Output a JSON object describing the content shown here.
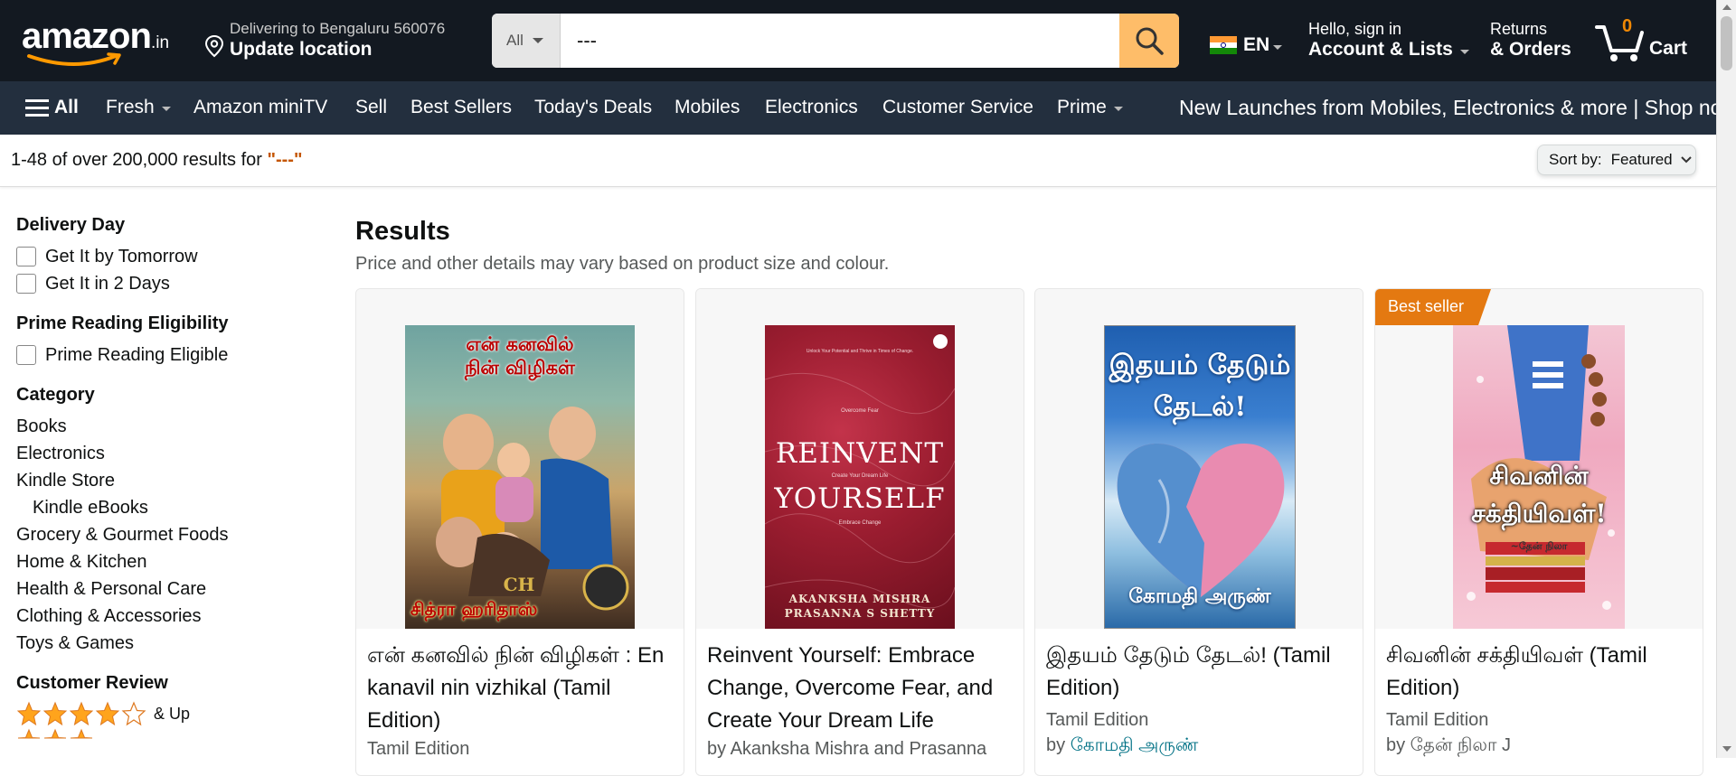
{
  "header": {
    "logo_text": "amazon",
    "logo_tld": ".in",
    "deliver_line1": "Delivering to Bengaluru 560076",
    "deliver_line2": "Update location",
    "search_category": "All",
    "search_value": "---",
    "language": "EN",
    "account_line1": "Hello, sign in",
    "account_line2": "Account & Lists",
    "orders_line1": "Returns",
    "orders_line2": "& Orders",
    "cart_count": "0",
    "cart_label": "Cart",
    "colors": {
      "nav_bg": "#131921",
      "subnav_bg": "#232f3e",
      "search_button": "#febd69",
      "cart_count": "#f08804"
    }
  },
  "subnav": {
    "all": "All",
    "items": [
      "Fresh",
      "Amazon miniTV",
      "Sell",
      "Best Sellers",
      "Today's Deals",
      "Mobiles",
      "Electronics",
      "Customer Service",
      "Prime"
    ],
    "promo": "New Launches from Mobiles, Electronics & more | Shop now"
  },
  "results_bar": {
    "prefix": "1-48 of over 200,000 results for ",
    "query": "\"---\"",
    "sort_label": "Sort by:",
    "sort_value": "Featured"
  },
  "sidebar": {
    "delivery_heading": "Delivery Day",
    "delivery_options": [
      "Get It by Tomorrow",
      "Get It in 2 Days"
    ],
    "prime_heading": "Prime Reading Eligibility",
    "prime_option": "Prime Reading Eligible",
    "category_heading": "Category",
    "categories": [
      "Books",
      "Electronics",
      "Kindle Store",
      "Kindle eBooks",
      "Grocery & Gourmet Foods",
      "Home & Kitchen",
      "Health & Personal Care",
      "Clothing & Accessories",
      "Toys & Games"
    ],
    "review_heading": "Customer Review",
    "review_stars": 4,
    "review_suffix": "& Up"
  },
  "main": {
    "heading": "Results",
    "subheading": "Price and other details may vary based on product size and colour.",
    "products": [
      {
        "title": "என் கனவில் நின் விழிகள் : En kanavil nin vizhikal (Tamil Edition)",
        "edition": "Tamil Edition",
        "cover_top": "என் கனவில்",
        "cover_mid": "நின் விழிகள்",
        "cover_author": "சித்ரா ஹரிதாஸ்",
        "cover_mark": "CH"
      },
      {
        "title": "Reinvent Yourself: Embrace Change, Overcome Fear, and Create Your Dream Life",
        "author_prefix": "by Akanksha Mishra and Prasanna",
        "cover_small_top": "Unlock Your Potential and Thrive in Times of Change.",
        "cover_line1": "REINVENT",
        "cover_line2": "YOURSELF",
        "cover_small1": "Overcome Fear",
        "cover_small2": "Create Your Dream Life",
        "cover_small3": "Embrace Change",
        "cover_author1": "AKANKSHA MISHRA",
        "cover_author2": "PRASANNA S SHETTY"
      },
      {
        "title": "இதயம் தேடும் தேடல்! (Tamil Edition)",
        "edition": "Tamil Edition",
        "author_prefix": "by ",
        "author_link": "கோமதி அருண்",
        "cover_line1": "இதயம் தேடும்",
        "cover_line2": "தேடல்!",
        "cover_author": "கோமதி அருண்"
      },
      {
        "badge": "Best seller",
        "title": "சிவனின் சக்தியிவள் (Tamil Edition)",
        "edition": "Tamil Edition",
        "author_prefix": "by தேன் நிலா J",
        "cover_line1": "சிவனின்",
        "cover_line2": "சக்தியிவள்!",
        "cover_author": "~தேன் நிலா"
      }
    ]
  }
}
